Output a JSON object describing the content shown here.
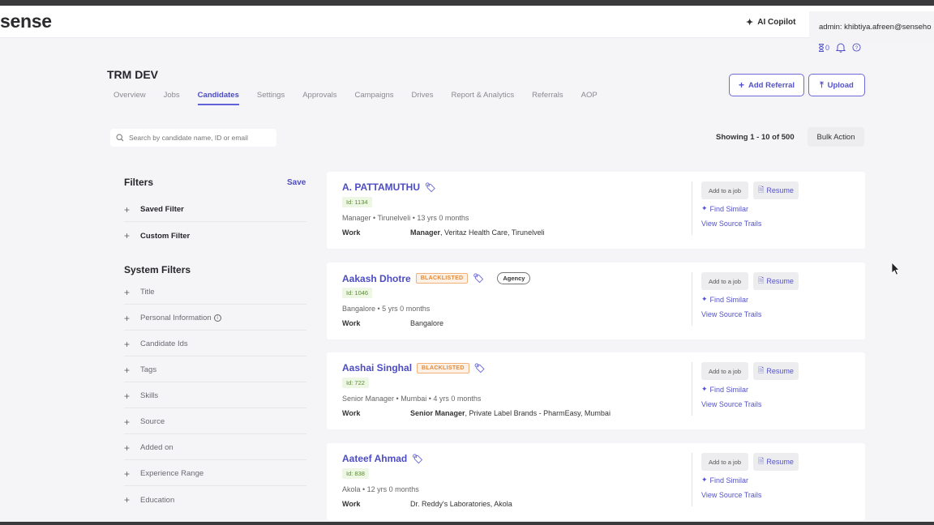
{
  "topbar": {
    "logo": "sense",
    "copilot": "AI Copilot",
    "admin": "admin: khibtiya.afreen@senseho",
    "hourglass_count": "0"
  },
  "project": {
    "title": "TRM DEV",
    "tabs": [
      "Overview",
      "Jobs",
      "Candidates",
      "Settings",
      "Approvals",
      "Campaigns",
      "Drives",
      "Report & Analytics",
      "Referrals",
      "AOP"
    ],
    "active_tab": "Candidates",
    "add_referral": "Add Referral",
    "upload": "Upload"
  },
  "toolbar": {
    "search_placeholder": "Search by candidate name, ID or email",
    "showing": "Showing 1 - 10 of 500",
    "bulk_action": "Bulk Action"
  },
  "filters": {
    "title": "Filters",
    "save": "Save",
    "saved_filter": "Saved Filter",
    "custom_filter": "Custom Filter",
    "system_title": "System Filters",
    "system_items": [
      "Title",
      "Personal Information",
      "Candidate Ids",
      "Tags",
      "Skills",
      "Source",
      "Added on",
      "Experience Range",
      "Education"
    ]
  },
  "card_actions": {
    "add_to_job": "Add to a job",
    "resume": "Resume",
    "find_similar": "Find Similar",
    "view_source_trails": "View Source Trails",
    "work_label": "Work"
  },
  "candidates": [
    {
      "name": "A. PATTAMUTHU",
      "blacklisted": "",
      "agency": "",
      "id": "Id: 1134",
      "subtitle": "Manager • Tirunelveli • 13 yrs 0 months",
      "work_role": "Manager",
      "work_rest": ", Veritaz Health Care, Tirunelveli"
    },
    {
      "name": "Aakash Dhotre",
      "blacklisted": "BLACKLISTED",
      "agency": "Agency",
      "id": "Id: 1046",
      "subtitle": "Bangalore • 5 yrs 0 months",
      "work_role": "",
      "work_rest": "Bangalore"
    },
    {
      "name": "Aashai Singhal",
      "blacklisted": "BLACKLISTED",
      "agency": "",
      "id": "Id: 722",
      "subtitle": "Senior Manager • Mumbai • 4 yrs 0 months",
      "work_role": "Senior Manager",
      "work_rest": ", Private Label Brands - PharmEasy, Mumbai"
    },
    {
      "name": "Aateef Ahmad",
      "blacklisted": "",
      "agency": "",
      "id": "Id: 838",
      "subtitle": "Akola • 12 yrs 0 months",
      "work_role": "",
      "work_rest": "Dr. Reddy's Laboratories, Akola"
    }
  ],
  "colors": {
    "accent": "#5352c9",
    "blacklist": "#e48a3a",
    "id_green": "#5b8a3a"
  }
}
